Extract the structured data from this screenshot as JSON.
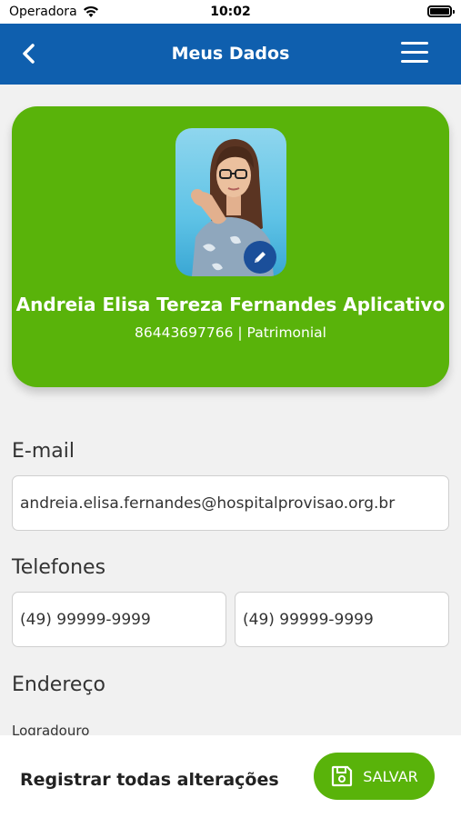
{
  "status_bar": {
    "carrier": "Operadora",
    "time": "10:02",
    "wifi_icon": "wifi-icon",
    "battery_icon": "battery-icon"
  },
  "header": {
    "title": "Meus Dados",
    "back_icon": "chevron-left-icon",
    "menu_icon": "hamburger-menu-icon",
    "color": "#0f5fae"
  },
  "profile": {
    "name": "Andreia Elisa Tereza Fernandes Aplicativo",
    "subtitle": "86443697766 | Patrimonial",
    "edit_icon": "pencil-icon",
    "card_color": "#59b30a"
  },
  "form": {
    "email_label": "E-mail",
    "email_value": "andreia.elisa.fernandes@hospitalprovisao.org.br",
    "phones_label": "Telefones",
    "phone1_value": "(49) 99999-9999",
    "phone2_value": "(49) 99999-9999",
    "address_label": "Endereço",
    "street_label": "Logradouro"
  },
  "footer": {
    "register_text": "Registrar todas alterações",
    "save_label": "SALVAR",
    "save_icon": "floppy-disk-icon"
  }
}
